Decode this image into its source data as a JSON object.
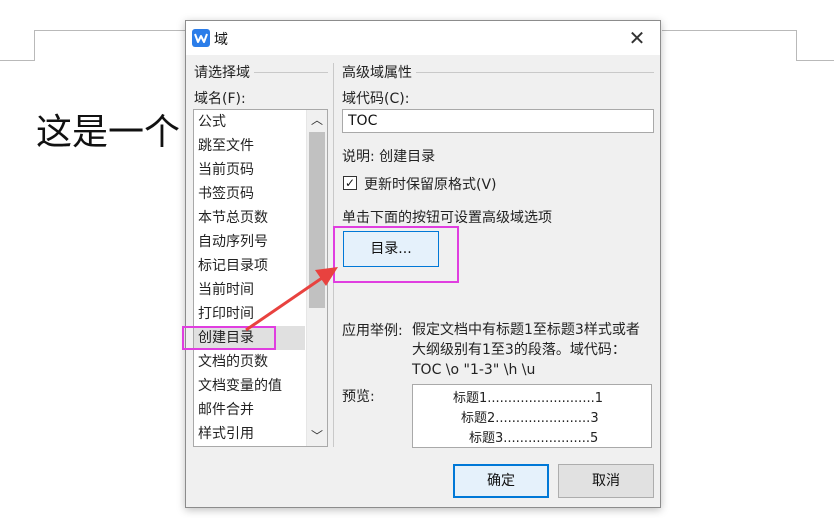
{
  "document": {
    "body_text": "这是一个"
  },
  "dialog": {
    "title": "域",
    "close_glyph": "✕",
    "left": {
      "group_title": "请选择域",
      "field_name_label": "域名(F):",
      "items": [
        "公式",
        "跳至文件",
        "当前页码",
        "书签页码",
        "本节总页数",
        "自动序列号",
        "标记目录项",
        "当前时间",
        "打印时间",
        "创建目录",
        "文档的页数",
        "文档变量的值",
        "邮件合并",
        "样式引用"
      ],
      "selected_item": "创建目录"
    },
    "right": {
      "group_title": "高级域属性",
      "code_label": "域代码(C):",
      "code_value": "TOC",
      "description": "说明: 创建目录",
      "preserve_format_label": "更新时保留原格式(V)",
      "preserve_format_checked": true,
      "hint": "单击下面的按钮可设置高级域选项",
      "toc_button_label": "目录...",
      "example_label": "应用举例:",
      "example_text": "假定文档中有标题1至标题3样式或者大纲级别有1至3的段落。域代码：TOC \\o \"1-3\" \\h \\u",
      "preview_label": "预览:",
      "preview_lines": [
        "标题1..........................1",
        "标题2.......................3",
        "标题3.....................5"
      ]
    },
    "ok_label": "确定",
    "cancel_label": "取消"
  },
  "colors": {
    "highlight": "#e03ee0",
    "arrow": "#e8423f",
    "accent": "#0078d7",
    "app_icon": "#2b7de9"
  },
  "icons": {
    "app": "wps-writer-icon",
    "close": "close-icon",
    "check": "checkmark-icon",
    "scroll_up": "chevron-up-icon",
    "scroll_down": "chevron-down-icon"
  }
}
